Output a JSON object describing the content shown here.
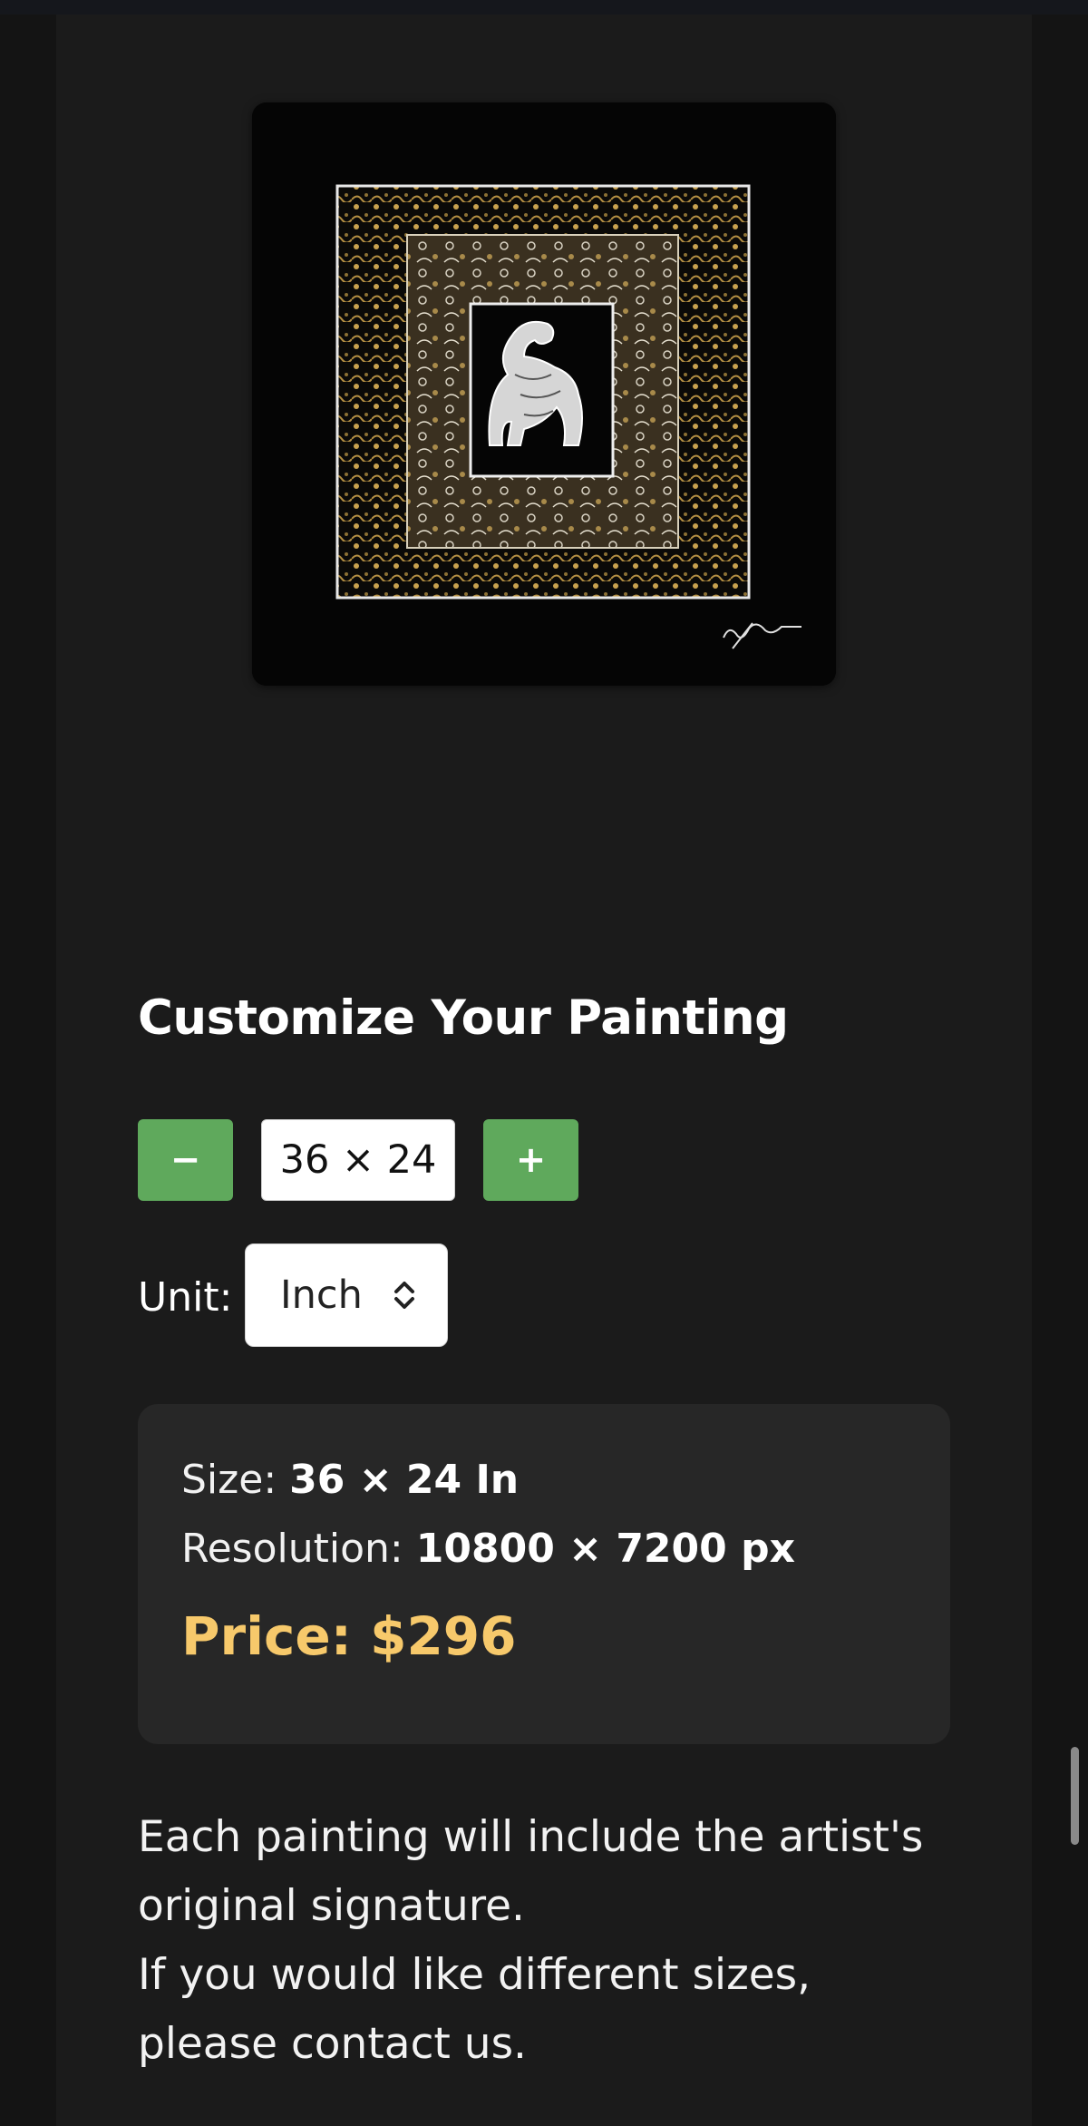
{
  "artwork": {
    "signature_icon": "artist-signature"
  },
  "customize": {
    "heading": "Customize Your Painting",
    "decrease_label": "−",
    "size_value": "36 × 24",
    "increase_label": "+",
    "unit_label": "Unit:",
    "unit_selected": "Inch",
    "unit_icon": "chevron-up-down-icon"
  },
  "summary": {
    "size_label": "Size:",
    "size_value": "36 × 24 In",
    "resolution_label": "Resolution:",
    "resolution_value": "10800 × 7200 px",
    "price_text": "Price: $296"
  },
  "notes": [
    "Each painting will include the artist's",
    "original signature.",
    "If you would like different sizes,",
    "please contact us."
  ],
  "colors": {
    "background": "#141414",
    "panel": "#1b1b1b",
    "button_green": "#5fa95c",
    "summary_bg": "#272727",
    "price_gold": "#f7c96b"
  }
}
